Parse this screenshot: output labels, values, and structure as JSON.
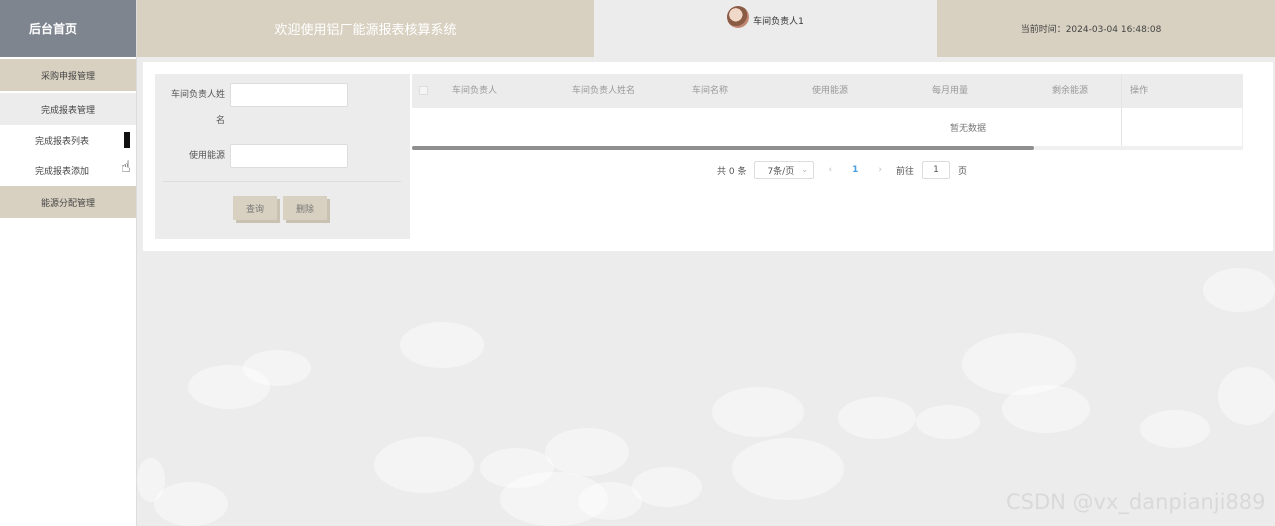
{
  "sidebar": {
    "home": "后台首页",
    "items": [
      {
        "label": "采购申报管理"
      },
      {
        "label": "完成报表管理"
      },
      {
        "label": "完成报表列表"
      },
      {
        "label": "完成报表添加"
      },
      {
        "label": "能源分配管理"
      }
    ]
  },
  "header": {
    "title": "欢迎使用铝厂能源报表核算系统",
    "user": "车间负责人1",
    "time": "当前时间：2024-03-04 16:48:08"
  },
  "search": {
    "name_label": "车间负责人姓名",
    "energy_label": "使用能源",
    "query_btn": "查询",
    "delete_btn": "删除"
  },
  "table": {
    "columns": [
      "车间负责人",
      "车间负责人姓名",
      "车间名称",
      "使用能源",
      "每月用量",
      "剩余能源",
      "操作"
    ],
    "empty": "暂无数据"
  },
  "pagination": {
    "total": "共 0 条",
    "page_size": "7条/页",
    "current_page": "1",
    "goto_prefix": "前往",
    "goto_value": "1",
    "goto_suffix": "页"
  },
  "watermark": "CSDN @vx_danpianji889",
  "colors": {
    "accent": "#d8d1c1",
    "sidebar_head": "#7f858f",
    "page_bg": "#ececec",
    "active_page": "#4aa0e6"
  }
}
